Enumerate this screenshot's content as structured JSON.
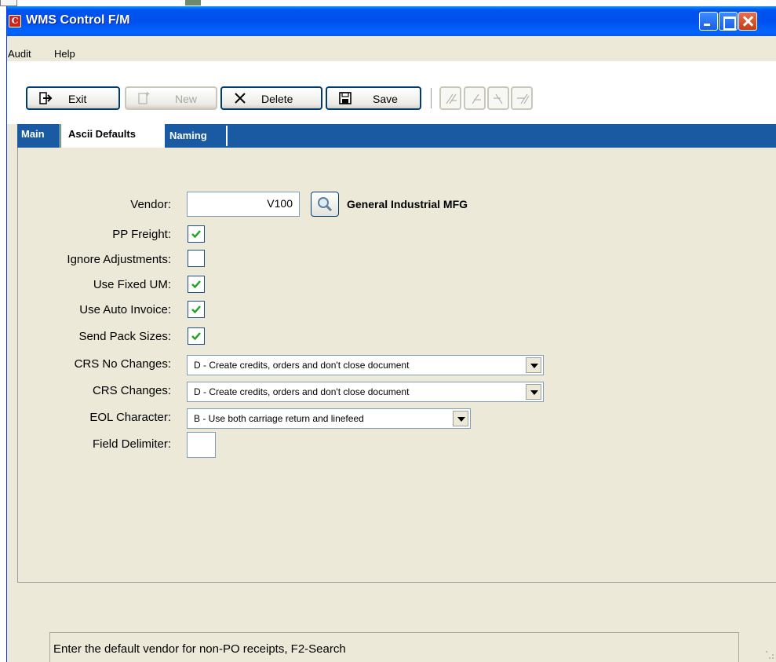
{
  "window": {
    "title": "WMS Control F/M",
    "icon": "app-logo-icon"
  },
  "menu": {
    "items": [
      "Audit",
      "Help"
    ]
  },
  "toolbar": {
    "exit_label": "Exit",
    "new_label": "New",
    "delete_label": "Delete",
    "save_label": "Save",
    "icons": [
      "exit-icon",
      "new-icon",
      "delete-x-icon",
      "save-disk-icon",
      "first-record-icon",
      "previous-record-icon",
      "next-record-icon",
      "last-record-icon"
    ]
  },
  "tabs": [
    {
      "label": "Main",
      "active": false
    },
    {
      "label": "Ascii Defaults",
      "active": true
    },
    {
      "label": "Naming",
      "active": false
    }
  ],
  "form": {
    "vendor": {
      "label": "Vendor:",
      "value": "V100",
      "name": "General Industrial MFG"
    },
    "pp_freight": {
      "label": "PP Freight:",
      "checked": true
    },
    "ignore_adjustments": {
      "label": "Ignore Adjustments:",
      "checked": false
    },
    "use_fixed_um": {
      "label": "Use Fixed UM:",
      "checked": true
    },
    "use_auto_invoice": {
      "label": "Use Auto Invoice:",
      "checked": true
    },
    "send_pack_sizes": {
      "label": "Send Pack Sizes:",
      "checked": true
    },
    "crs_no_changes": {
      "label": "CRS No Changes:",
      "value": "D - Create credits, orders and don't close document"
    },
    "crs_changes": {
      "label": "CRS Changes:",
      "value": "D - Create credits, orders and don't close document"
    },
    "eol_character": {
      "label": "EOL Character:",
      "value": "B - Use both carriage return and linefeed"
    },
    "field_delimiter": {
      "label": "Field Delimiter:",
      "value": ""
    }
  },
  "status": {
    "message": "Enter the default vendor for non-PO receipts, F2-Search"
  },
  "colors": {
    "titlebar": "#0053ee",
    "tabstrip": "#1a5aa3",
    "checkmark": "#21a121",
    "window_bg": "#ece9d8"
  }
}
